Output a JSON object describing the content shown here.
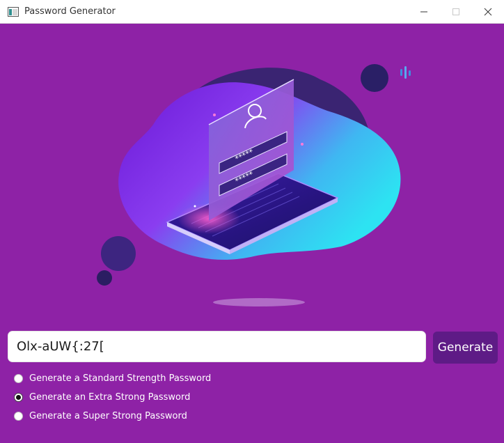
{
  "window": {
    "title": "Password Generator",
    "icon": "app-window-icon",
    "controls": [
      "minimize-icon",
      "maximize-icon",
      "close-icon"
    ]
  },
  "colors": {
    "background": "#8e22a6",
    "button": "#5e1b86",
    "field": "#ffffff"
  },
  "illustration": {
    "icon": "login-laptop-illustration",
    "masked_glyphs": "*****"
  },
  "password_field": {
    "value": "Olx-aUW{:27["
  },
  "generate_button": {
    "label": "Generate"
  },
  "options": [
    {
      "label": "Generate a Standard Strength Password",
      "checked": false
    },
    {
      "label": "Generate an Extra Strong Password",
      "checked": true
    },
    {
      "label": "Generate a Super Strong Password",
      "checked": false
    }
  ]
}
